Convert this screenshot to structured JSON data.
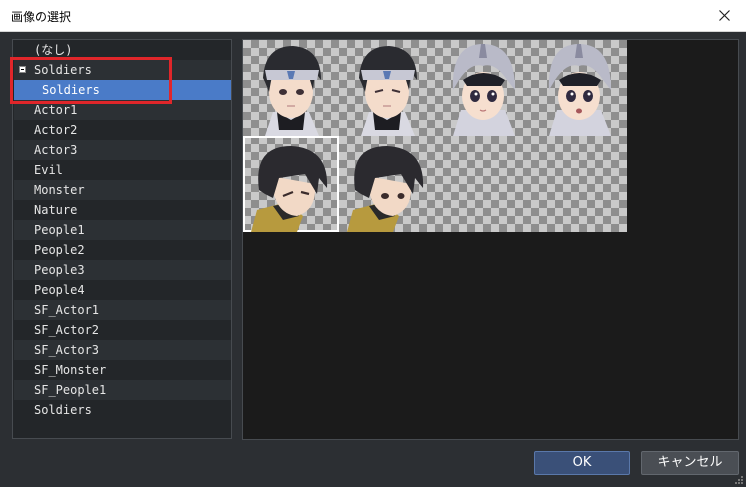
{
  "window": {
    "title": "画像の選択"
  },
  "list": {
    "items": [
      {
        "label": "(なし)",
        "kind": "none"
      },
      {
        "label": "Soldiers",
        "kind": "folder",
        "expanded": true
      },
      {
        "label": "Soldiers",
        "kind": "child",
        "selected": true
      },
      {
        "label": "Actor1",
        "kind": "file"
      },
      {
        "label": "Actor2",
        "kind": "file"
      },
      {
        "label": "Actor3",
        "kind": "file"
      },
      {
        "label": "Evil",
        "kind": "file"
      },
      {
        "label": "Monster",
        "kind": "file"
      },
      {
        "label": "Nature",
        "kind": "file"
      },
      {
        "label": "People1",
        "kind": "file"
      },
      {
        "label": "People2",
        "kind": "file"
      },
      {
        "label": "People3",
        "kind": "file"
      },
      {
        "label": "People4",
        "kind": "file"
      },
      {
        "label": "SF_Actor1",
        "kind": "file"
      },
      {
        "label": "SF_Actor2",
        "kind": "file"
      },
      {
        "label": "SF_Actor3",
        "kind": "file"
      },
      {
        "label": "SF_Monster",
        "kind": "file"
      },
      {
        "label": "SF_People1",
        "kind": "file"
      },
      {
        "label": "Soldiers",
        "kind": "file"
      }
    ]
  },
  "preview": {
    "faces": [
      {
        "type": "soldier-headband"
      },
      {
        "type": "soldier-headband"
      },
      {
        "type": "soldier-helmet"
      },
      {
        "type": "soldier-helmet-surprised"
      },
      {
        "type": "soldier-dark-hair",
        "selected": true
      },
      {
        "type": "soldier-dark-hair"
      },
      {
        "type": "empty"
      },
      {
        "type": "empty"
      }
    ]
  },
  "buttons": {
    "ok": "OK",
    "cancel": "キャンセル"
  },
  "colors": {
    "selection": "#4a7bc8",
    "highlight_box": "#e0262a"
  }
}
